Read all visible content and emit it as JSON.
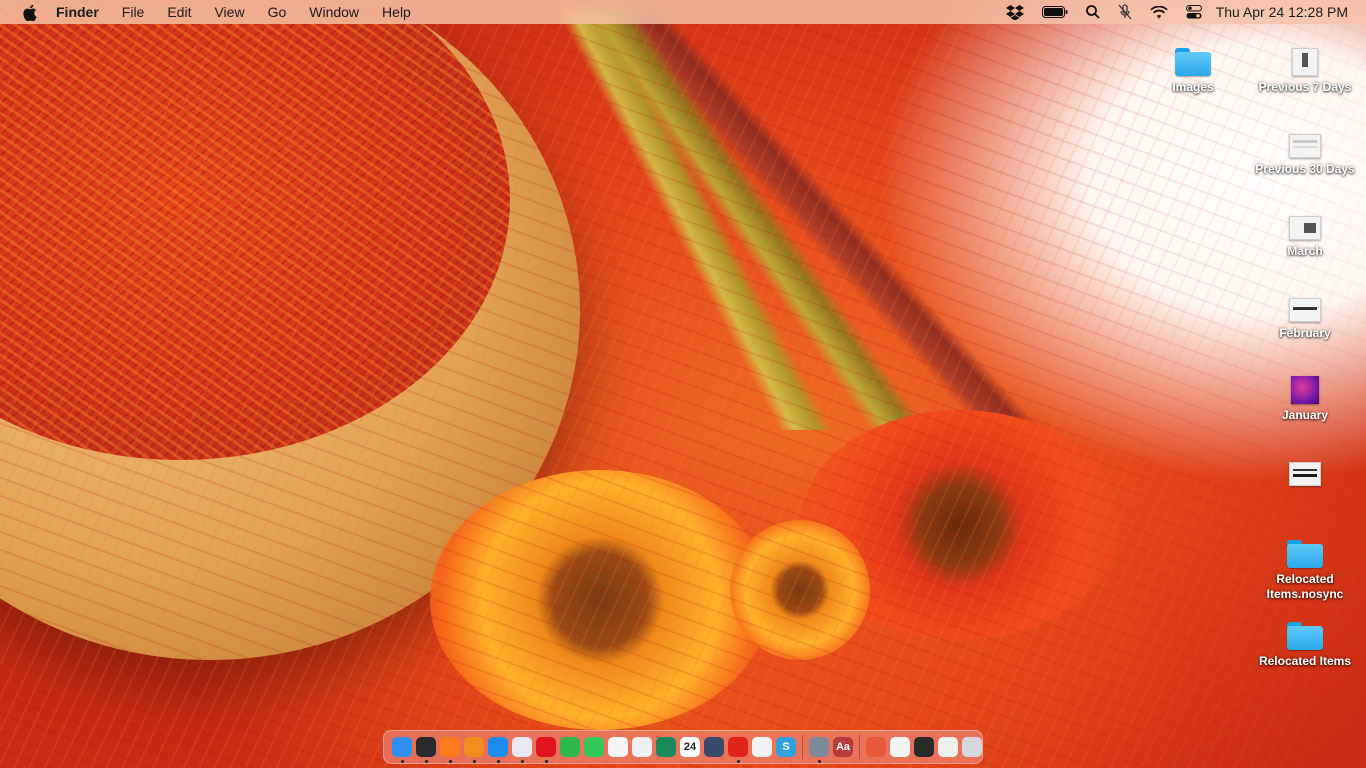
{
  "menubar": {
    "app_name": "Finder",
    "menus": [
      "File",
      "Edit",
      "View",
      "Go",
      "Window",
      "Help"
    ],
    "status_icons": [
      "dropbox-icon",
      "battery-icon",
      "spotlight-search-icon",
      "microphone-off-icon",
      "wifi-icon",
      "control-center-icon"
    ],
    "clock": "Thu Apr 24  12:28 PM"
  },
  "desktop": {
    "items": [
      {
        "label": "Images",
        "kind": "folder"
      },
      {
        "label": "Previous 7 Days",
        "kind": "document"
      },
      {
        "label": "Previous 30 Days",
        "kind": "document"
      },
      {
        "label": "March",
        "kind": "document"
      },
      {
        "label": "February",
        "kind": "document"
      },
      {
        "label": "January",
        "kind": "image"
      },
      {
        "label": "",
        "kind": "document"
      },
      {
        "label": "Relocated\nItems.nosync",
        "kind": "folder"
      },
      {
        "label": "Relocated Items",
        "kind": "folder"
      }
    ]
  },
  "dock": {
    "apps": [
      {
        "name": "finder",
        "color": "#2f8ff0",
        "running": true
      },
      {
        "name": "terminal",
        "color": "#2a2a2a",
        "running": true
      },
      {
        "name": "firefox",
        "color": "#ff7a1a",
        "running": true
      },
      {
        "name": "sublime-text",
        "color": "#f28c1e",
        "running": true
      },
      {
        "name": "safari",
        "color": "#1c8cf0",
        "running": true
      },
      {
        "name": "sequel-app",
        "color": "#e8e8f0",
        "running": true
      },
      {
        "name": "opera",
        "color": "#e0141e",
        "running": true
      },
      {
        "name": "circle-app",
        "color": "#2fb84a",
        "running": false
      },
      {
        "name": "facetime",
        "color": "#34c759",
        "running": false
      },
      {
        "name": "emoji-app",
        "color": "#f5f5f5",
        "running": false
      },
      {
        "name": "openai",
        "color": "#f0f0f0",
        "running": false
      },
      {
        "name": "script-app",
        "color": "#1a8a5a",
        "running": false
      },
      {
        "name": "calendar",
        "color": "#ffffff",
        "running": false,
        "text": "24"
      },
      {
        "name": "screen-share",
        "color": "#3a4a6a",
        "running": false
      },
      {
        "name": "creative-cloud",
        "color": "#e2231a",
        "running": true
      },
      {
        "name": "preview",
        "color": "#f2f2f2",
        "running": false
      },
      {
        "name": "s-app",
        "color": "#2fa0e0",
        "running": false,
        "text": "S"
      }
    ],
    "system": [
      {
        "name": "system-preferences",
        "color": "#7a8a9a",
        "running": true
      },
      {
        "name": "dictionary",
        "color": "#b83a3a",
        "running": false,
        "text": "Aa"
      }
    ],
    "recents": [
      {
        "name": "stack-1",
        "color": "#e85a3a"
      },
      {
        "name": "stack-2",
        "color": "#f2f2f2"
      },
      {
        "name": "stack-3",
        "color": "#2a2a2a"
      },
      {
        "name": "stack-4",
        "color": "#f0f0f0"
      },
      {
        "name": "trash",
        "color": "#d8d8dc"
      }
    ]
  }
}
